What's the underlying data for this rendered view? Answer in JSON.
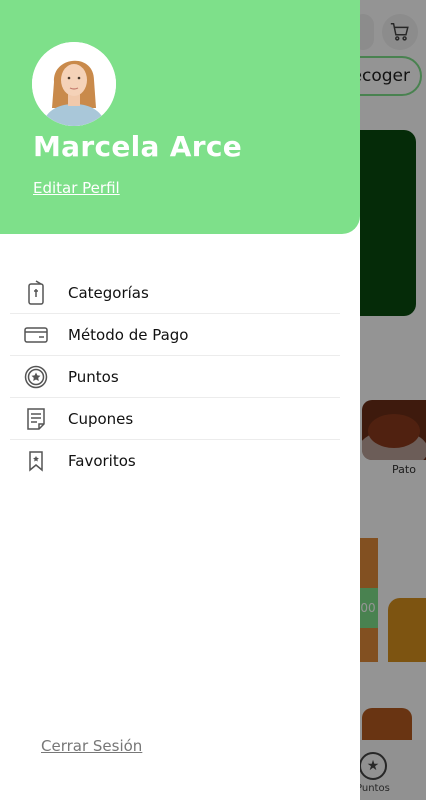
{
  "background": {
    "recoger_label": "ecoger",
    "food_label": "Pato",
    "card_badge": "00",
    "bottom_tab_label": "Puntos"
  },
  "drawer": {
    "header_color": "#7ee08a",
    "user_name": "Marcela Arce",
    "edit_profile_label": "Editar Perfil",
    "menu": [
      {
        "label": "Categorías",
        "icon": "phone-card-icon"
      },
      {
        "label": "Método de Pago",
        "icon": "credit-card-icon"
      },
      {
        "label": "Puntos",
        "icon": "star-badge-icon"
      },
      {
        "label": "Cupones",
        "icon": "coupon-icon"
      },
      {
        "label": "Favoritos",
        "icon": "bookmark-icon"
      }
    ],
    "logout_label": "Cerrar Sesión"
  }
}
